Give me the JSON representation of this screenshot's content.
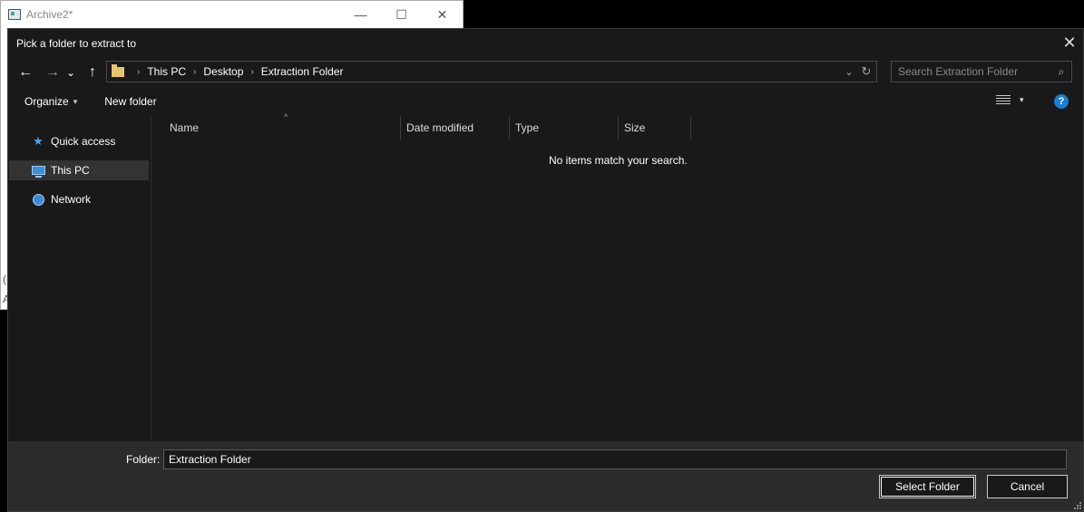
{
  "background_window": {
    "title": "Archive2*",
    "minimize": "—",
    "maximize": "☐",
    "close": "✕",
    "frag1": "(",
    "frag2": "A"
  },
  "dialog": {
    "title": "Pick a folder to extract to",
    "close": "✕"
  },
  "nav": {
    "back": "←",
    "forward": "→",
    "recent": "⌄",
    "up": "↑"
  },
  "address": {
    "breadcrumbs": [
      "This PC",
      "Desktop",
      "Extraction Folder"
    ],
    "separator": "›",
    "dropdown": "⌄",
    "refresh": "↻"
  },
  "search": {
    "placeholder": "Search Extraction Folder",
    "icon": "⌕"
  },
  "toolbar": {
    "organize": "Organize",
    "organize_caret": "▾",
    "new_folder": "New folder",
    "view_caret": "▾",
    "help": "?"
  },
  "sidebar": {
    "items": [
      {
        "label": "Quick access",
        "icon": "star-icon"
      },
      {
        "label": "This PC",
        "icon": "computer-icon",
        "selected": true
      },
      {
        "label": "Network",
        "icon": "network-icon"
      }
    ]
  },
  "file_list": {
    "columns": [
      "Name",
      "Date modified",
      "Type",
      "Size"
    ],
    "sort_indicator": "^",
    "empty_message": "No items match your search."
  },
  "footer": {
    "folder_label": "Folder:",
    "folder_value": "Extraction Folder",
    "select_button": "Select Folder",
    "cancel_button": "Cancel"
  },
  "colors": {
    "dialog_bg": "#191919",
    "footer_bg": "#2b2b2b",
    "accent_blue": "#1a7fd4",
    "folder_yellow": "#e7c66a"
  }
}
